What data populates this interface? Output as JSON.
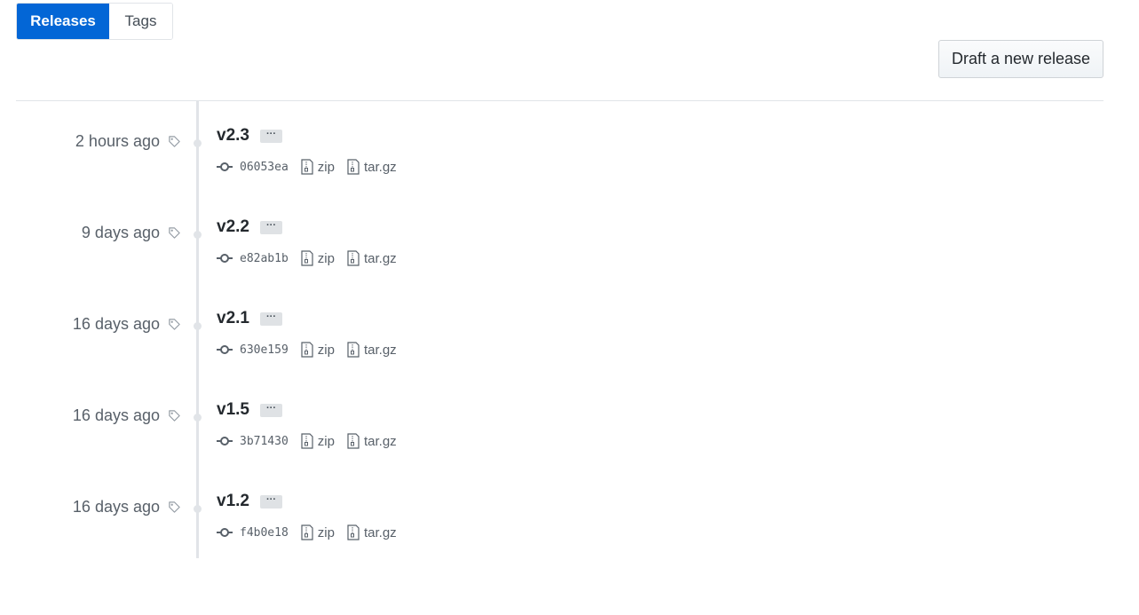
{
  "tabs": [
    {
      "label": "Releases",
      "selected": true
    },
    {
      "label": "Tags",
      "selected": false
    }
  ],
  "draft_button_label": "Draft a new release",
  "releases": [
    {
      "date": "2 hours ago",
      "name": "v2.3",
      "sha": "06053ea",
      "zip": "zip",
      "targz": "tar.gz"
    },
    {
      "date": "9 days ago",
      "name": "v2.2",
      "sha": "e82ab1b",
      "zip": "zip",
      "targz": "tar.gz"
    },
    {
      "date": "16 days ago",
      "name": "v2.1",
      "sha": "630e159",
      "zip": "zip",
      "targz": "tar.gz"
    },
    {
      "date": "16 days ago",
      "name": "v1.5",
      "sha": "3b71430",
      "zip": "zip",
      "targz": "tar.gz"
    },
    {
      "date": "16 days ago",
      "name": "v1.2",
      "sha": "f4b0e18",
      "zip": "zip",
      "targz": "tar.gz"
    }
  ],
  "ellipsis_label": "···",
  "colors": {
    "accent": "#0366d6",
    "muted_text": "#586069",
    "border": "#e1e4e8"
  },
  "icons": {
    "tag": "tag-icon",
    "commit": "git-commit-icon",
    "file": "file-zip-icon"
  }
}
